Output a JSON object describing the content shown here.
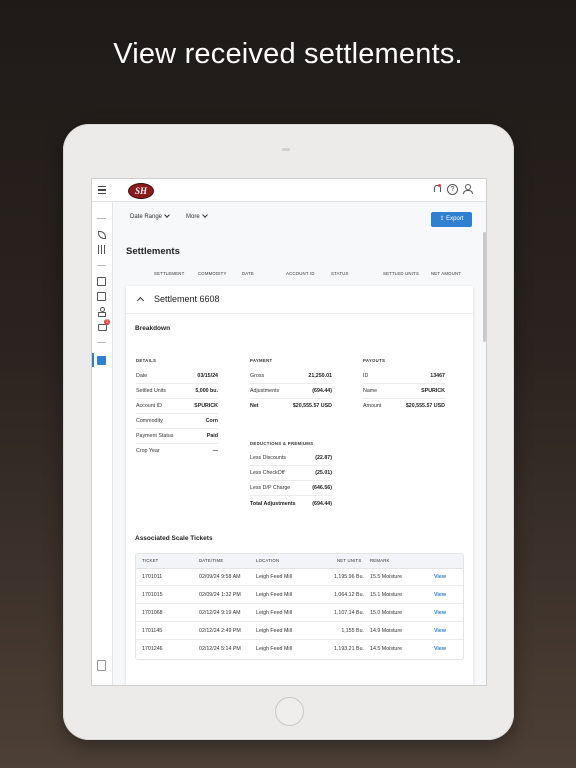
{
  "headline": "View received settlements.",
  "app": {
    "logo_text": "SH",
    "accent_color": "#2f80d1"
  },
  "topbar": {
    "menu_icon": "hamburger-icon",
    "icons": [
      "bell-icon",
      "help-icon",
      "user-icon"
    ],
    "help_text": "?"
  },
  "sidenav": {
    "icons": [
      "leaf-icon",
      "sliders-icon",
      "archive-icon",
      "document-icon",
      "person-icon",
      "truck-icon",
      "settlement-doc-icon",
      "trash-icon"
    ],
    "badge": "1"
  },
  "filters": {
    "date_range_label": "Date Range",
    "more_label": "More",
    "export_label": "Export"
  },
  "page": {
    "title": "Settlements",
    "columns": [
      "SETTLEMENT",
      "COMMODITY",
      "DATE",
      "ACCOUNT ID",
      "STATUS",
      "SETTLED UNITS",
      "NET AMOUNT"
    ]
  },
  "settlement": {
    "title": "Settlement 6608",
    "breakdown_label": "Breakdown",
    "details": {
      "title": "DETAILS",
      "rows": [
        {
          "label": "Date",
          "value": "03/15/24"
        },
        {
          "label": "Settled Units",
          "value": "5,000 bu."
        },
        {
          "label": "Account ID",
          "value": "SPURICK"
        },
        {
          "label": "Commodity",
          "value": "Corn"
        },
        {
          "label": "Payment Status",
          "value": "Paid"
        },
        {
          "label": "Crop Year",
          "value": "—"
        }
      ]
    },
    "payment": {
      "title": "PAYMENT",
      "rows": [
        {
          "label": "Gross",
          "value": "21,250.01"
        },
        {
          "label": "Adjustments",
          "value": "(694.44)"
        },
        {
          "label": "Net",
          "value": "$20,555.57 USD"
        }
      ]
    },
    "deductions": {
      "title": "DEDUCTIONS & PREMIUMS",
      "rows": [
        {
          "label": "Less Discounts",
          "value": "(22.87)"
        },
        {
          "label": "Less CheckOff",
          "value": "(25.01)"
        },
        {
          "label": "Less D/P Charge",
          "value": "(646.56)"
        },
        {
          "label": "Total Adjustments",
          "value": "(694.44)"
        }
      ]
    },
    "payouts": {
      "title": "PAYOUTS",
      "rows": [
        {
          "label": "ID",
          "value": "13467"
        },
        {
          "label": "Name",
          "value": "SPURICK"
        },
        {
          "label": "Amount",
          "value": "$20,555.57 USD"
        }
      ]
    },
    "tickets": {
      "title": "Associated Scale Tickets",
      "headers": [
        "TICKET",
        "DATE/TIME",
        "LOCATION",
        "NET UNITS",
        "REMARK"
      ],
      "rows": [
        {
          "ticket": "1701011",
          "datetime": "02/09/24 9:58 AM",
          "location": "Leigh Feed Mill",
          "net_units": "1,195.96 Bu.",
          "remark": "15.5 Moisture",
          "action": "View"
        },
        {
          "ticket": "1701015",
          "datetime": "02/09/24 1:32 PM",
          "location": "Leigh Feed Mill",
          "net_units": "1,064.12 Bu.",
          "remark": "15.1 Moisture",
          "action": "View"
        },
        {
          "ticket": "1701068",
          "datetime": "02/12/24 9:19 AM",
          "location": "Leigh Feed Mill",
          "net_units": "1,107.14 Bu.",
          "remark": "15.0 Moisture",
          "action": "View"
        },
        {
          "ticket": "1701145",
          "datetime": "02/12/24 2:49 PM",
          "location": "Leigh Feed Mill",
          "net_units": "1,155 Bu.",
          "remark": "14.9 Moisture",
          "action": "View"
        },
        {
          "ticket": "1701246",
          "datetime": "02/12/24 5:14 PM",
          "location": "Leigh Feed Mill",
          "net_units": "1,193.21 Bu.",
          "remark": "14.5 Moisture",
          "action": "View"
        }
      ]
    }
  }
}
